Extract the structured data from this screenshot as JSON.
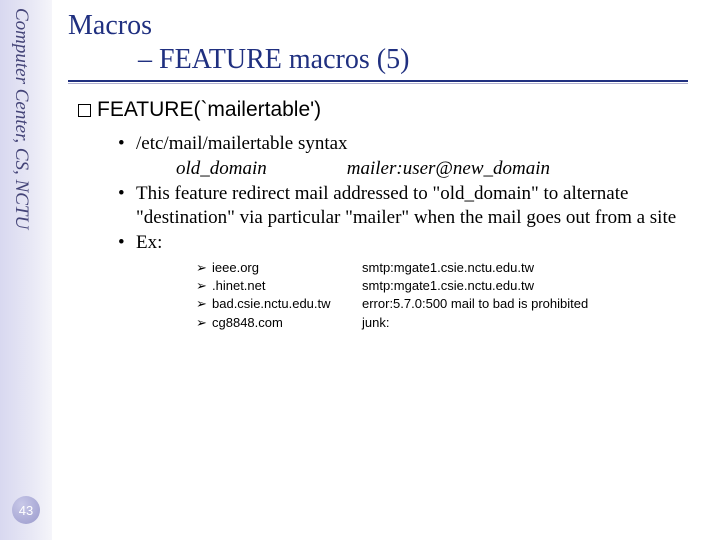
{
  "sidebar": {
    "org_text": "Computer Center, CS, NCTU",
    "page_number": "43"
  },
  "title": {
    "line1": "Macros",
    "line2": "– FEATURE macros (5)"
  },
  "section": {
    "heading": "FEATURE(`mailertable')",
    "bullets": [
      {
        "text": "/etc/mail/mailertable syntax",
        "syntax": {
          "left": "old_domain",
          "right": "mailer:user@new_domain"
        }
      },
      {
        "text": "This feature redirect mail addressed to \"old_domain\" to alternate \"destination\" via particular \"mailer\" when the mail goes out from a site"
      },
      {
        "text": "Ex:",
        "examples": [
          {
            "domain": "ieee.org",
            "target": "smtp:mgate1.csie.nctu.edu.tw"
          },
          {
            "domain": ".hinet.net",
            "target": "smtp:mgate1.csie.nctu.edu.tw"
          },
          {
            "domain": "bad.csie.nctu.edu.tw",
            "target": "error:5.7.0:500 mail to bad is prohibited"
          },
          {
            "domain": "cg8848.com",
            "target": "junk:"
          }
        ]
      }
    ]
  }
}
